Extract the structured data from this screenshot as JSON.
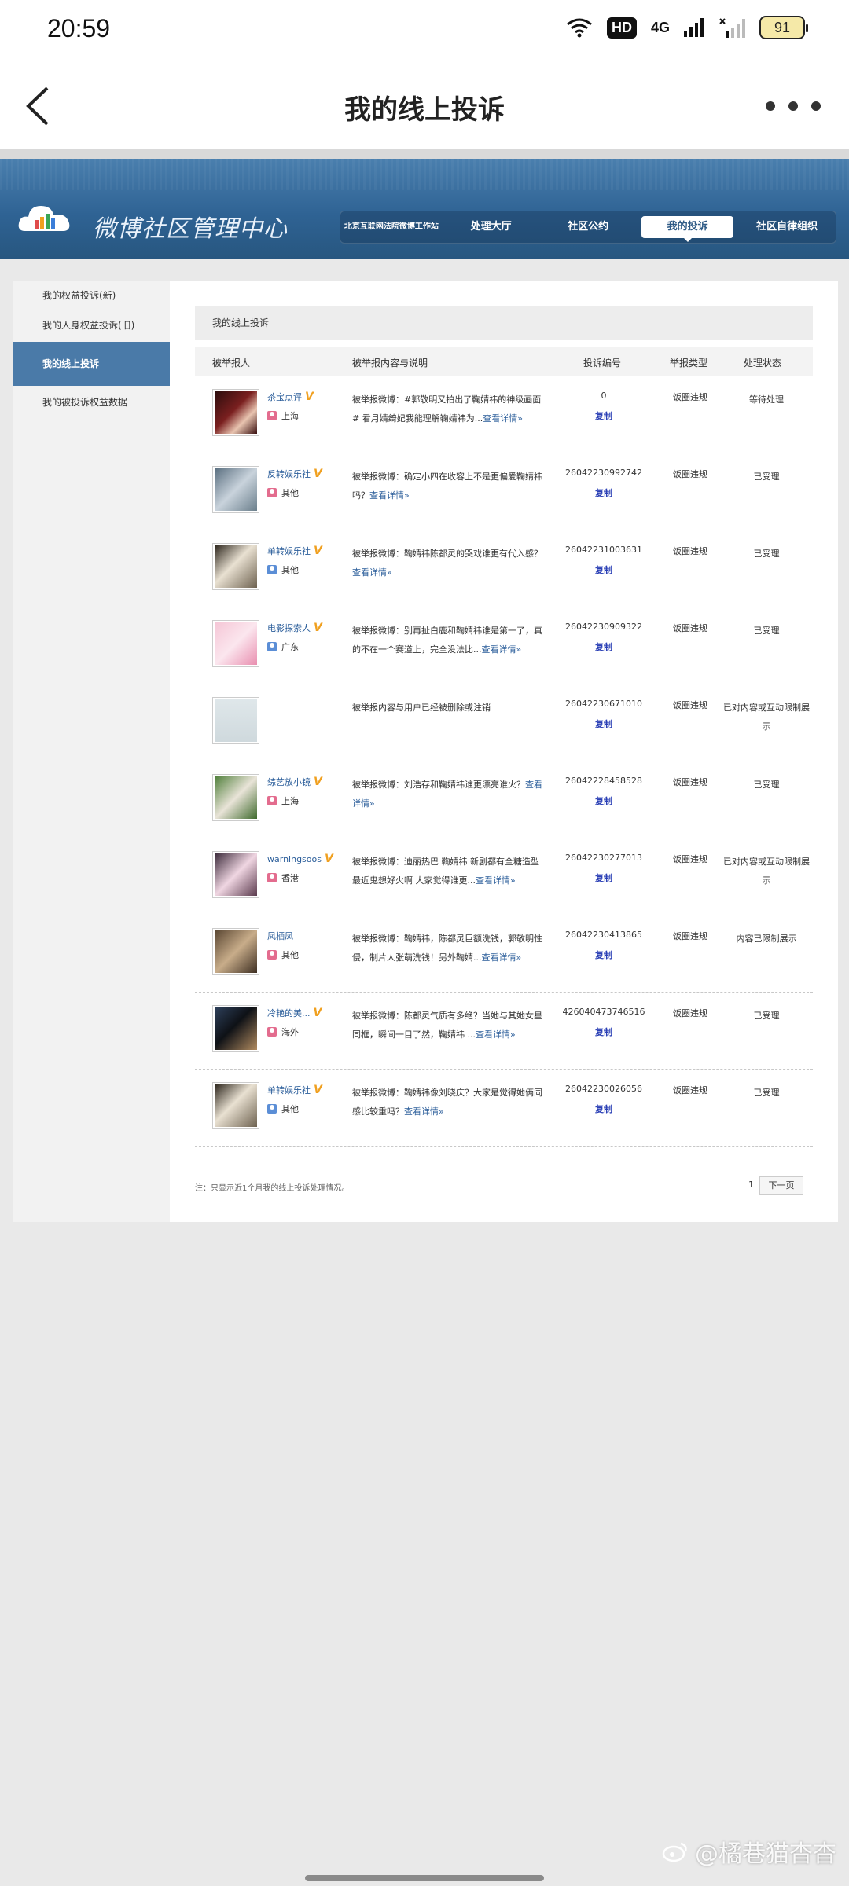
{
  "status_bar": {
    "time": "20:59",
    "hd": "HD",
    "net": "4G",
    "battery": "91"
  },
  "app_header": {
    "title": "我的线上投诉"
  },
  "banner": {
    "title": "微博社区管理中心",
    "nav": [
      "北京互联网法院微博工作站",
      "处理大厅",
      "社区公约",
      "我的投诉",
      "社区自律组织"
    ],
    "active_nav": "我的投诉"
  },
  "sidebar": {
    "items": [
      "我的权益投诉(新)",
      "我的人身权益投诉(旧)",
      "我的线上投诉",
      "我的被投诉权益数据"
    ],
    "active": "我的线上投诉"
  },
  "content": {
    "title": "我的线上投诉",
    "columns": [
      "被举报人",
      "被举报内容与说明",
      "投诉编号",
      "举报类型",
      "处理状态"
    ],
    "copy_label": "复制",
    "rows": [
      {
        "user": "茶宝点评",
        "verified": true,
        "location": "上海",
        "gender": "f",
        "desc": "被举报微博：#郭敬明又拍出了鞠婧祎的神级画面# 看月婧绮妃我能理解鞠婧祎为...",
        "more": "查看详情»",
        "id": "0",
        "type": "饭圈违规",
        "status": "等待处理"
      },
      {
        "user": "反转娱乐社",
        "verified": true,
        "location": "其他",
        "gender": "f",
        "desc": "被举报微博：确定小四在收容上不是更偏爱鞠婧祎吗？",
        "more": "查看详情»",
        "id": "26042230992742",
        "type": "饭圈违规",
        "status": "已受理"
      },
      {
        "user": "单转娱乐社",
        "verified": true,
        "location": "其他",
        "gender": "m",
        "desc": "被举报微博：鞠婧祎陈都灵的哭戏谁更有代入感？",
        "more": "查看详情»",
        "id": "26042231003631",
        "type": "饭圈违规",
        "status": "已受理"
      },
      {
        "user": "电影探索人",
        "verified": true,
        "location": "广东",
        "gender": "m",
        "desc": "被举报微博：别再扯白鹿和鞠婧祎谁是第一了，真的不在一个赛道上，完全没法比...",
        "more": "查看详情»",
        "id": "26042230909322",
        "type": "饭圈违规",
        "status": "已受理"
      },
      {
        "user": "",
        "verified": false,
        "location": "",
        "gender": "",
        "desc": "被举报内容与用户已经被删除或注销",
        "more": "",
        "id": "26042230671010",
        "type": "饭圈违规",
        "status": "已对内容或互动限制展示"
      },
      {
        "user": "综艺放小镜",
        "verified": true,
        "location": "上海",
        "gender": "f",
        "desc": "被举报微博：刘浩存和鞠婧祎谁更漂亮谁火？",
        "more": "查看详情»",
        "id": "26042228458528",
        "type": "饭圈违规",
        "status": "已受理"
      },
      {
        "user": "warningsoos",
        "verified": true,
        "location": "香港",
        "gender": "f",
        "desc": "被举报微博：迪丽热巴 鞠婧祎 新剧都有全糖造型 最近鬼想好火啊 大家觉得谁更...",
        "more": "查看详情»",
        "id": "26042230277013",
        "type": "饭圈违规",
        "status": "已对内容或互动限制展示"
      },
      {
        "user": "凤栖凤",
        "verified": false,
        "location": "其他",
        "gender": "f",
        "desc": "被举报微博：鞠婧祎，陈都灵巨额洗钱，郭敬明性侵，制片人张萌洗钱！另外鞠婧...",
        "more": "查看详情»",
        "id": "26042230413865",
        "type": "饭圈违规",
        "status": "内容已限制展示"
      },
      {
        "user": "冷艳的美...",
        "verified": true,
        "location": "海外",
        "gender": "f",
        "desc": "被举报微博：陈都灵气质有多绝？当她与其她女星同框，瞬间一目了然，鞠婧祎 ...",
        "more": "查看详情»",
        "id": "426040473746516",
        "type": "饭圈违规",
        "status": "已受理"
      },
      {
        "user": "单转娱乐社",
        "verified": true,
        "location": "其他",
        "gender": "m",
        "desc": "被举报微博：鞠婧祎像刘晓庆？大家是觉得她俩同感比较重吗？",
        "more": "查看详情»",
        "id": "26042230026056",
        "type": "饭圈违规",
        "status": "已受理"
      }
    ],
    "footer_note": "注：只显示近1个月我的线上投诉处理情况。",
    "page": "1",
    "next_label": "下一页"
  },
  "watermark": "@橘巷猫杳杳",
  "colors": {
    "banner": "#2f6394",
    "link": "#2a5d9a",
    "sidebar_active": "#4a7aa8",
    "verified": "#f0a020"
  }
}
